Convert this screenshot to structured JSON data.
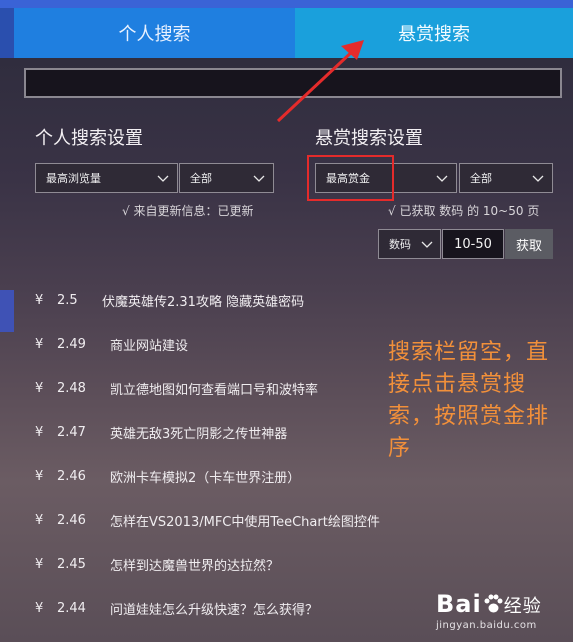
{
  "tabs": {
    "personal": "个人搜索",
    "reward": "悬赏搜索"
  },
  "search": {
    "value": ""
  },
  "personal_settings": {
    "title": "个人搜索设置",
    "sort_dropdown": "最高浏览量",
    "scope_dropdown": "全部",
    "status": "√ 来自更新信息：已更新"
  },
  "reward_settings": {
    "title": "悬赏搜索设置",
    "sort_dropdown": "最高赏金",
    "scope_dropdown": "全部",
    "status": "√ 已获取 数码 的 10~50 页",
    "pages_dropdown": "数码",
    "range_value": "10-50",
    "fetch_button": "获取"
  },
  "results": [
    {
      "yen": "¥",
      "amount": "2.5",
      "title": "伏魔英雄传2.31攻略 隐藏英雄密码"
    },
    {
      "yen": "¥",
      "amount": "2.49",
      "title": "商业网站建设"
    },
    {
      "yen": "¥",
      "amount": "2.48",
      "title": "凯立德地图如何查看端口号和波特率"
    },
    {
      "yen": "¥",
      "amount": "2.47",
      "title": "英雄无敌3死亡阴影之传世神器"
    },
    {
      "yen": "¥",
      "amount": "2.46",
      "title": "欧洲卡车模拟2（卡车世界注册）"
    },
    {
      "yen": "¥",
      "amount": "2.46",
      "title": "怎样在VS2013/MFC中使用TeeChart绘图控件"
    },
    {
      "yen": "¥",
      "amount": "2.45",
      "title": "怎样到达魔兽世界的达拉然？"
    },
    {
      "yen": "¥",
      "amount": "2.44",
      "title": "问道娃娃怎么升级快速？怎么获得？"
    }
  ],
  "annotation": "搜索栏留空，直接点击悬赏搜索，按照赏金排序",
  "watermark": {
    "brand": "Bai",
    "brand_suffix": "经验",
    "url": "jingyan.baidu.com"
  },
  "colors": {
    "accent_tab": "#1aa0dc",
    "annotation": "#f2903a",
    "highlight": "#e42b2b"
  }
}
